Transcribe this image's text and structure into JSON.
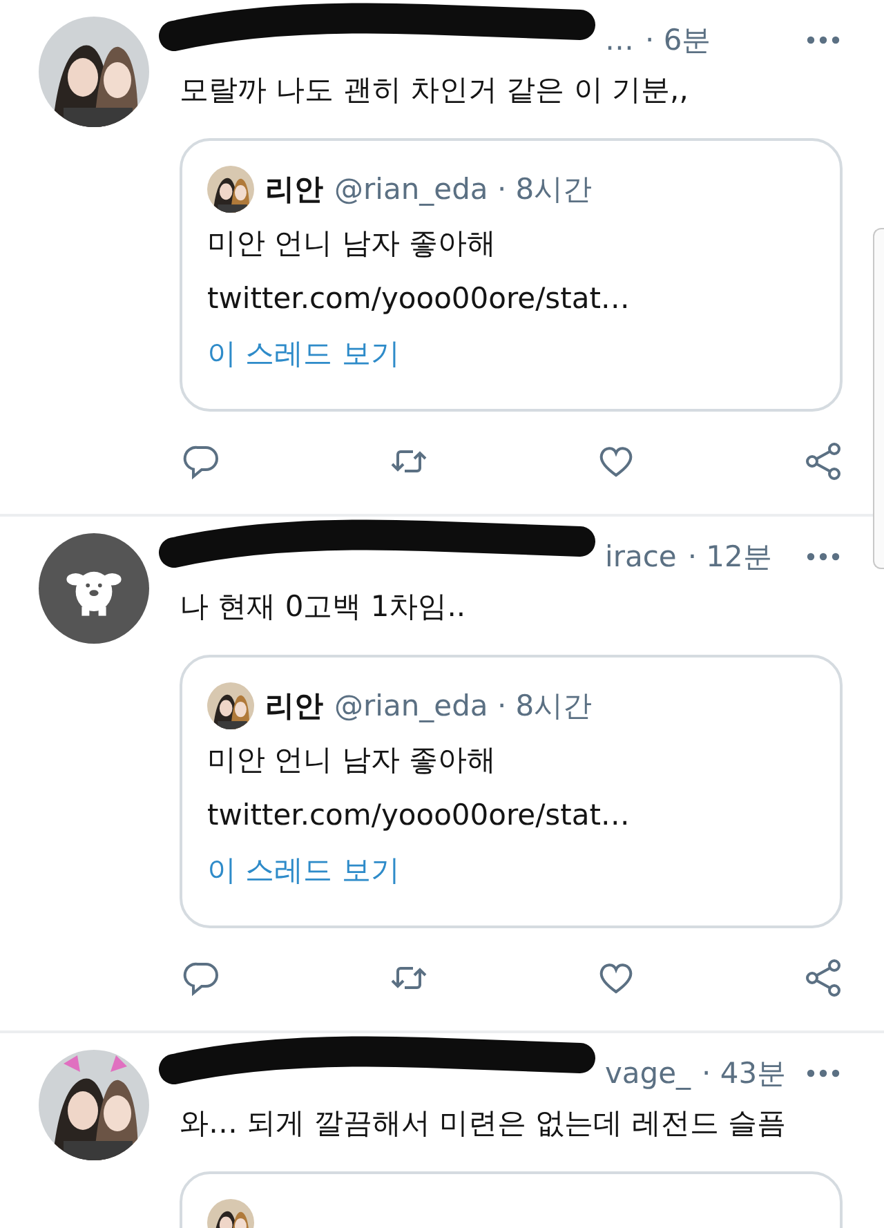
{
  "tweets": [
    {
      "name_redacted": true,
      "handle_fragment": "…",
      "time": "· 6분",
      "text": "모랄까 나도 괜히 차인거 같은 이 기분,,",
      "quote": {
        "name": "리안",
        "handle": "@rian_eda · 8시간",
        "text": "미안 언니 남자 좋아해",
        "link": "twitter.com/yooo00ore/stat…",
        "thread_link": "이 스레드 보기"
      }
    },
    {
      "avatar": {
        "kind": "mascot"
      },
      "name_redacted": true,
      "handle_fragment": "irace",
      "time": "· 12분",
      "text": "나 현재 0고백 1차임..",
      "quote": {
        "name": "리안",
        "handle": "@rian_eda · 8시간",
        "text": "미안 언니 남자 좋아해",
        "link": "twitter.com/yooo00ore/stat…",
        "thread_link": "이 스레드 보기"
      }
    },
    {
      "name_redacted": true,
      "handle_fragment": "vage_",
      "time": "· 43분",
      "text": "와… 되게 깔끔해서 미련은 없는데 레전드 슬픔",
      "quote": {
        "clipped": true
      }
    }
  ]
}
